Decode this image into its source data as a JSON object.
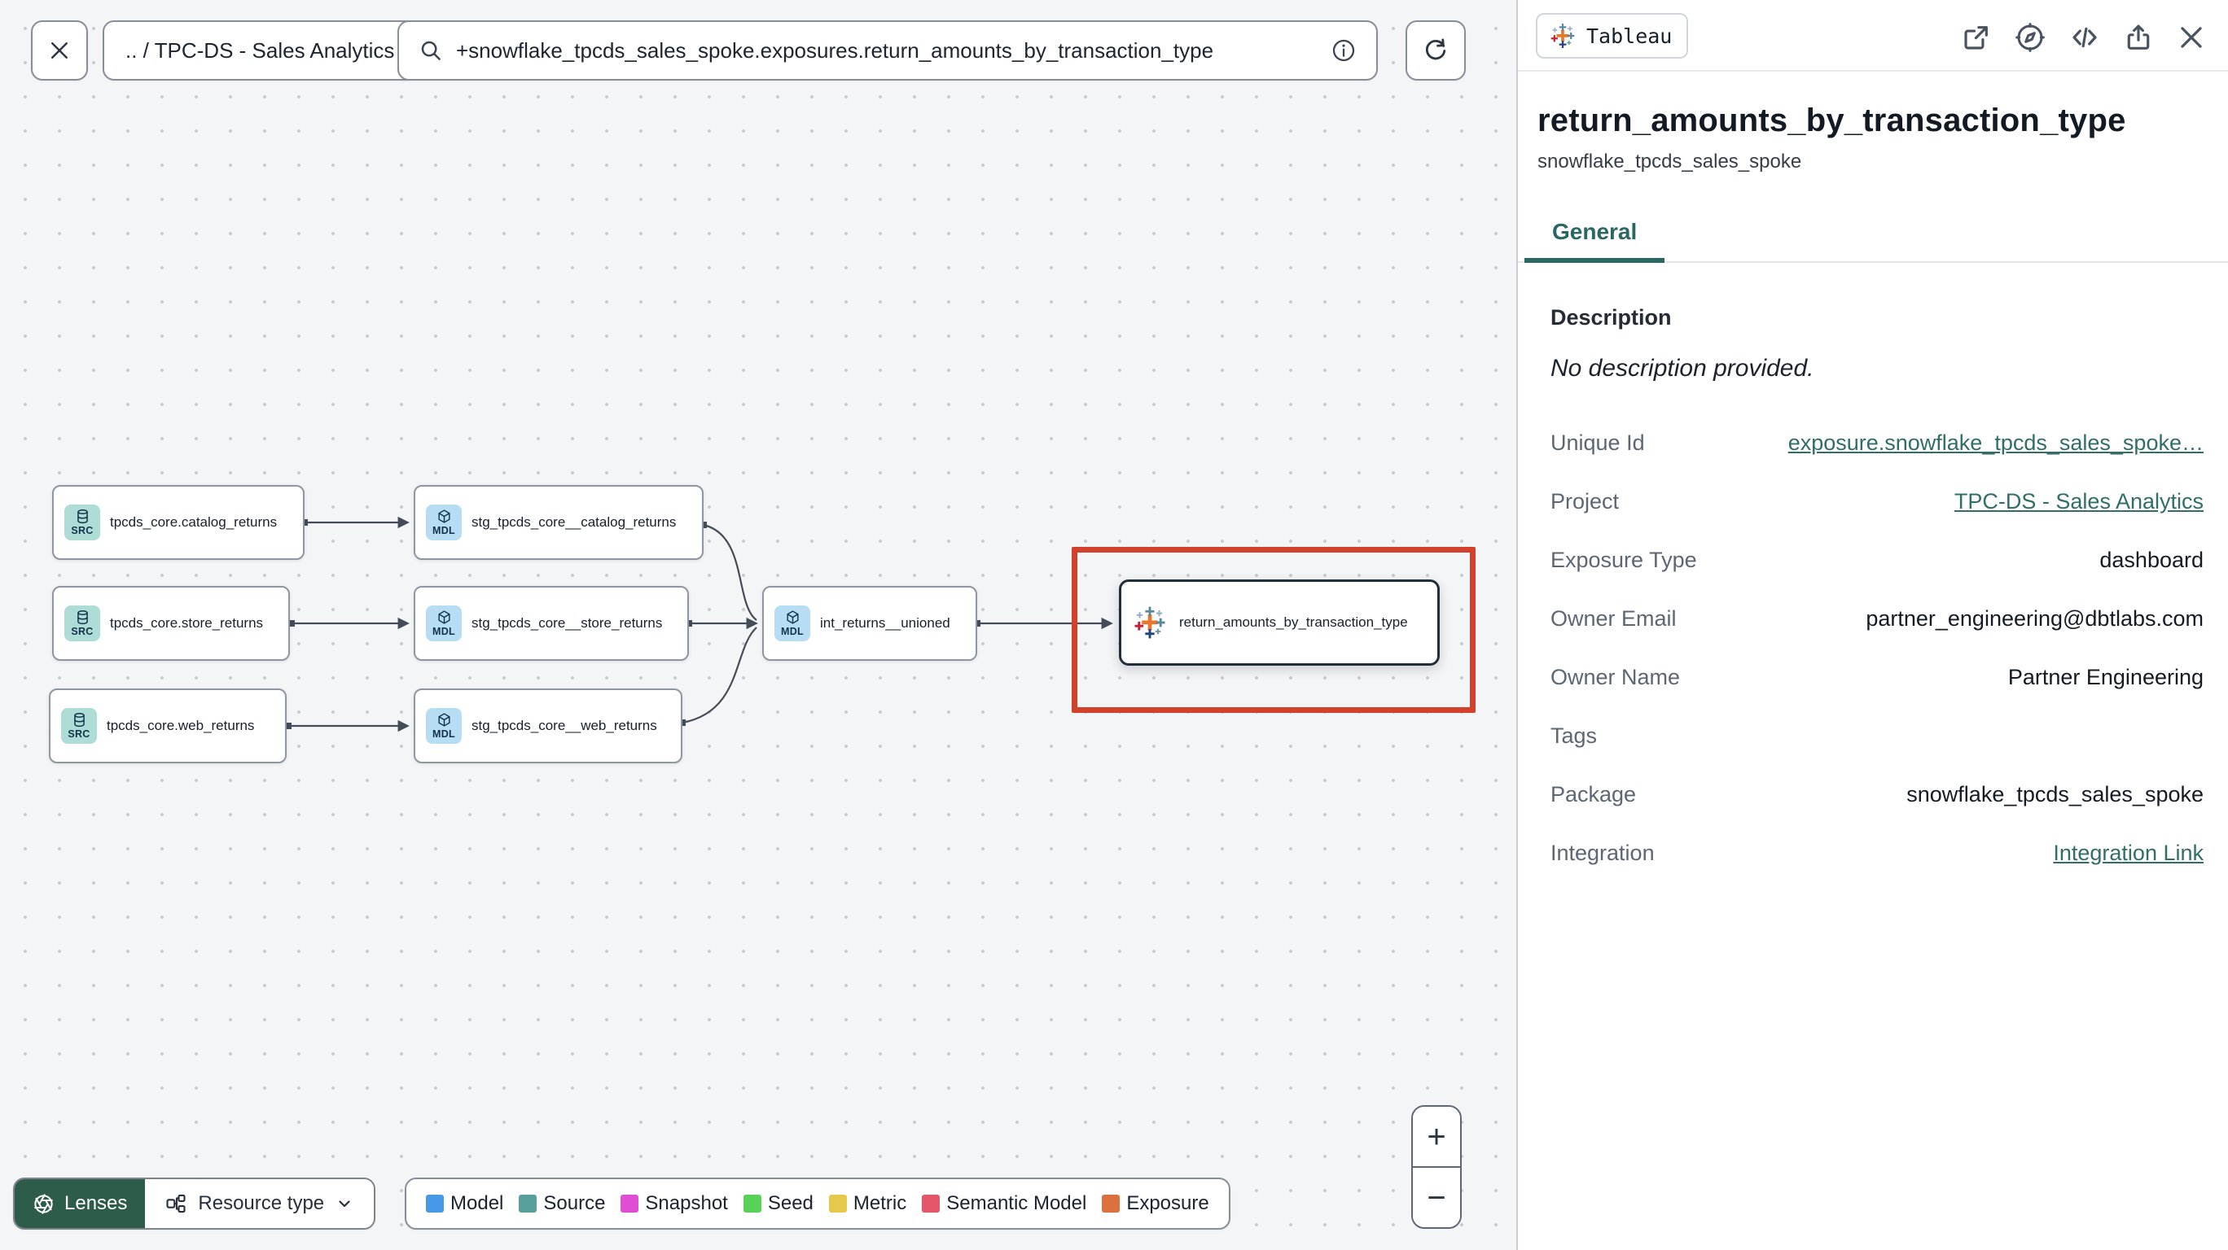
{
  "toolbar": {
    "breadcrumb": ".. / TPC-DS - Sales Analytics",
    "search_value": "+snowflake_tpcds_sales_spoke.exposures.return_amounts_by_transaction_type"
  },
  "graph": {
    "nodes": [
      {
        "type": "source",
        "badge": "SRC",
        "label": "tpcds_core.catalog_returns"
      },
      {
        "type": "source",
        "badge": "SRC",
        "label": "tpcds_core.store_returns"
      },
      {
        "type": "source",
        "badge": "SRC",
        "label": "tpcds_core.web_returns"
      },
      {
        "type": "model",
        "badge": "MDL",
        "label": "stg_tpcds_core__catalog_returns"
      },
      {
        "type": "model",
        "badge": "MDL",
        "label": "stg_tpcds_core__store_returns"
      },
      {
        "type": "model",
        "badge": "MDL",
        "label": "stg_tpcds_core__web_returns"
      },
      {
        "type": "model",
        "badge": "MDL",
        "label": "int_returns__unioned"
      },
      {
        "type": "exposure",
        "badge": "",
        "label": "return_amounts_by_transaction_type"
      }
    ],
    "highlight_color": "#d2412b"
  },
  "controls": {
    "lenses": "Lenses",
    "resource_type": "Resource type",
    "zoom_in": "+",
    "zoom_out": "−"
  },
  "legend": {
    "items": [
      {
        "label": "Model",
        "color": "#4799e8"
      },
      {
        "label": "Source",
        "color": "#57a09b"
      },
      {
        "label": "Snapshot",
        "color": "#e04fd3"
      },
      {
        "label": "Seed",
        "color": "#57d257"
      },
      {
        "label": "Metric",
        "color": "#e6c84a"
      },
      {
        "label": "Semantic Model",
        "color": "#e5566a"
      },
      {
        "label": "Exposure",
        "color": "#dc7140"
      }
    ]
  },
  "panel": {
    "type_chip": "Tableau",
    "title": "return_amounts_by_transaction_type",
    "subtitle": "snowflake_tpcds_sales_spoke",
    "tabs": [
      {
        "label": "General",
        "active": true
      }
    ],
    "description_heading": "Description",
    "description_empty": "No description provided.",
    "link_color": "#316e68",
    "fields": [
      {
        "label": "Unique Id",
        "value": "exposure.snowflake_tpcds_sales_spoke…",
        "link": true
      },
      {
        "label": "Project",
        "value": "TPC-DS - Sales Analytics",
        "link": true
      },
      {
        "label": "Exposure Type",
        "value": "dashboard",
        "link": false
      },
      {
        "label": "Owner Email",
        "value": "partner_engineering@dbtlabs.com",
        "link": false
      },
      {
        "label": "Owner Name",
        "value": "Partner Engineering",
        "link": false
      },
      {
        "label": "Tags",
        "value": "",
        "link": false
      },
      {
        "label": "Package",
        "value": "snowflake_tpcds_sales_spoke",
        "link": false
      },
      {
        "label": "Integration",
        "value": "Integration Link",
        "link": true
      }
    ]
  }
}
